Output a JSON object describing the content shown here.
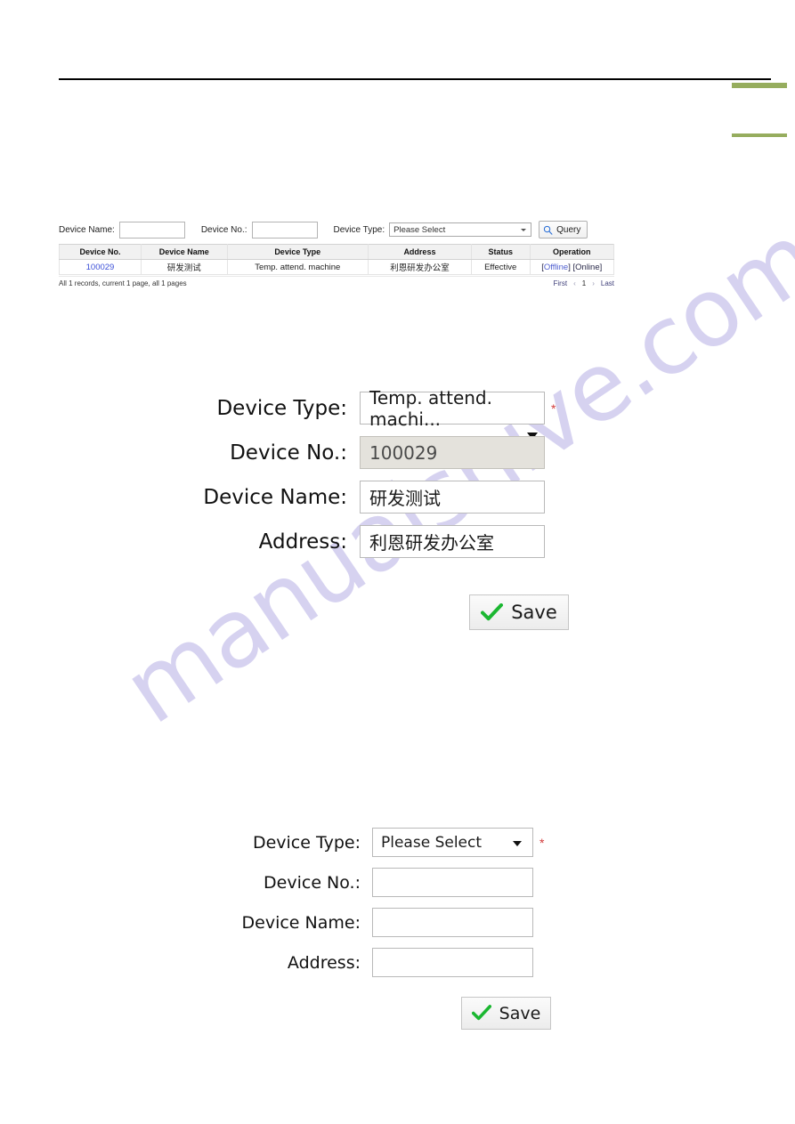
{
  "decoration": {
    "rule_color": "#000000",
    "accent_color": "#96ad5e",
    "watermark_text": "manualshive.com",
    "watermark_color": "#bdb7e8"
  },
  "list_screen": {
    "filters": {
      "device_name_label": "Device Name:",
      "device_name_value": "",
      "device_no_label": "Device No.:",
      "device_no_value": "",
      "device_type_label": "Device Type:",
      "device_type_value": "Please Select",
      "device_type_options": [
        "Please Select",
        "Temp. attend. machine"
      ],
      "query_label": "Query",
      "query_icon": "search-icon"
    },
    "table": {
      "columns": [
        "Device No.",
        "Device Name",
        "Device Type",
        "Address",
        "Status",
        "Operation"
      ],
      "rows": [
        {
          "device_no": "100029",
          "device_name": "研发测试",
          "device_type": "Temp. attend. machine",
          "address": "利恩研发办公室",
          "status": "Effective",
          "operation": {
            "offline": "Offline",
            "online": "Online",
            "open_bracket": "[",
            "close_bracket": "]"
          }
        }
      ]
    },
    "pagination": {
      "summary": "All 1 records, current 1 page, all 1 pages",
      "first": "First",
      "prev": "‹",
      "page": "1",
      "next": "›",
      "last": "Last"
    }
  },
  "form_edit": {
    "rows": [
      {
        "label": "Device Type:",
        "value": "Temp. attend. machi...",
        "required": true,
        "disabled": false,
        "control": "select"
      },
      {
        "label": "Device No.:",
        "value": "100029",
        "required": false,
        "disabled": true,
        "control": "text"
      },
      {
        "label": "Device Name:",
        "value": "研发测试",
        "required": false,
        "disabled": false,
        "control": "text"
      },
      {
        "label": "Address:",
        "value": "利恩研发办公室",
        "required": false,
        "disabled": false,
        "control": "text"
      }
    ],
    "required_marker": "*",
    "save_label": "Save",
    "save_icon": "check-icon"
  },
  "form_new": {
    "rows": [
      {
        "label": "Device Type:",
        "value": "Please Select",
        "required": true,
        "disabled": false,
        "control": "select"
      },
      {
        "label": "Device No.:",
        "value": "",
        "required": false,
        "disabled": false,
        "control": "text"
      },
      {
        "label": "Device Name:",
        "value": "",
        "required": false,
        "disabled": false,
        "control": "text"
      },
      {
        "label": "Address:",
        "value": "",
        "required": false,
        "disabled": false,
        "control": "text"
      }
    ],
    "required_marker": "*",
    "save_label": "Save",
    "save_icon": "check-icon"
  }
}
